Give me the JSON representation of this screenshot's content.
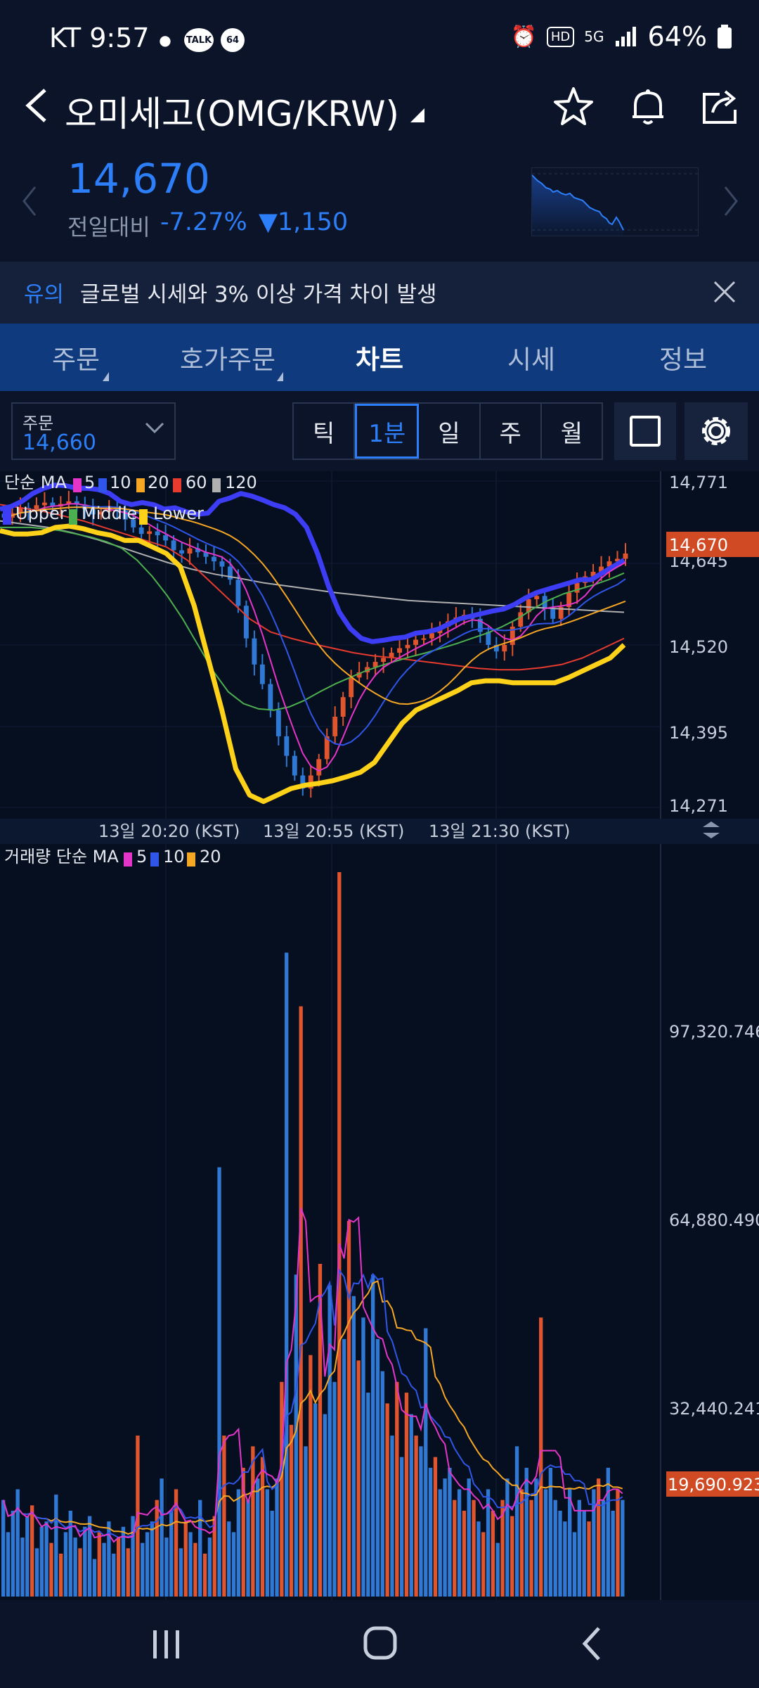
{
  "status_bar": {
    "carrier_time": "KT 9:57",
    "icons": [
      "location-icon",
      "talk-icon",
      "notification-dot-icon",
      "alarm-icon",
      "hd-icon",
      "5g-icon",
      "signal-icon",
      "battery-icon"
    ],
    "talk_label": "TALK",
    "dot_label": "64",
    "hd_label": "HD",
    "g5_label": "5G",
    "battery": "64%"
  },
  "header": {
    "title": "오미세고(OMG/KRW)"
  },
  "price": {
    "current": "14,670",
    "change_label": "전일대비",
    "change_pct": "-7.27%",
    "change_abs": "▼1,150",
    "color": "#2d7ff9"
  },
  "warning": {
    "tag": "유의",
    "text": "글로벌 시세와 3% 이상 가격 차이 발생"
  },
  "tabs": [
    {
      "label": "주문"
    },
    {
      "label": "호가주문"
    },
    {
      "label": "차트"
    },
    {
      "label": "시세"
    },
    {
      "label": "정보"
    }
  ],
  "toolbar": {
    "order_label": "주문",
    "order_value": "14,660",
    "intervals": [
      "틱",
      "1분",
      "일",
      "주",
      "월"
    ],
    "active_interval": "1분"
  },
  "chart_data": [
    {
      "type": "candlestick",
      "legend_ma": {
        "label": "단순 MA",
        "periods": [
          "5",
          "10",
          "20",
          "60",
          "120"
        ],
        "colors": [
          "#e535c8",
          "#2f56e8",
          "#f5a623",
          "#e63b2e",
          "#b0b0b0"
        ]
      },
      "legend_bb": {
        "labels": [
          "Upper",
          "Middle",
          "Lower"
        ],
        "colors": [
          "#3d3df5",
          "#4caf50",
          "#ffd21a"
        ]
      },
      "y_ticks": [
        "14,771",
        "14,645",
        "14,520",
        "14,395",
        "14,271"
      ],
      "y_range": [
        14271,
        14771
      ],
      "current_price_tag": "14,670",
      "x_ticks": [
        "13일 20:20 (KST)",
        "13일 20:55 (KST)",
        "13일 21:30 (KST)"
      ],
      "up_color": "#e0542e",
      "down_color": "#2f79d4",
      "close_series": [
        14715,
        14722,
        14730,
        14728,
        14734,
        14738,
        14732,
        14736,
        14740,
        14735,
        14728,
        14720,
        14724,
        14730,
        14726,
        14712,
        14700,
        14690,
        14694,
        14688,
        14680,
        14665,
        14660,
        14668,
        14662,
        14655,
        14648,
        14640,
        14620,
        14580,
        14530,
        14490,
        14460,
        14420,
        14380,
        14350,
        14320,
        14300,
        14320,
        14345,
        14380,
        14410,
        14440,
        14470,
        14478,
        14486,
        14494,
        14500,
        14508,
        14515,
        14520,
        14528,
        14530,
        14538,
        14548,
        14556,
        14562,
        14566,
        14560,
        14540,
        14520,
        14510,
        14520,
        14548,
        14570,
        14590,
        14595,
        14575,
        14560,
        14578,
        14600,
        14615,
        14625,
        14632,
        14640,
        14648,
        14652,
        14660
      ],
      "ma_values": {
        "upper": [
          14728,
          14732,
          14740,
          14752,
          14760,
          14765,
          14764,
          14760,
          14760,
          14758,
          14752,
          14740,
          14735,
          14738,
          14735,
          14728,
          14730,
          14724,
          14720,
          14722,
          14740,
          14745,
          14752,
          14748,
          14742,
          14735,
          14730,
          14720,
          14700,
          14660,
          14610,
          14570,
          14545,
          14530,
          14525,
          14527,
          14530,
          14532,
          14538,
          14540,
          14544,
          14552,
          14560,
          14564,
          14568,
          14572,
          14575,
          14582,
          14592,
          14600,
          14605,
          14610,
          14615,
          14620,
          14620,
          14630,
          14640,
          14650
        ],
        "middle": [
          14700,
          14700,
          14700,
          14698,
          14695,
          14690,
          14685,
          14678,
          14668,
          14650,
          14625,
          14595,
          14560,
          14520,
          14480,
          14448,
          14430,
          14422,
          14420,
          14425,
          14435,
          14448,
          14460,
          14470,
          14480,
          14488,
          14495,
          14502,
          14508,
          14515,
          14522,
          14530,
          14538,
          14548,
          14560,
          14575,
          14588,
          14598,
          14605,
          14612,
          14620,
          14630
        ],
        "lower": [
          14695,
          14690,
          14690,
          14692,
          14700,
          14702,
          14698,
          14692,
          14688,
          14680,
          14680,
          14670,
          14660,
          14640,
          14580,
          14500,
          14420,
          14330,
          14290,
          14280,
          14290,
          14300,
          14305,
          14308,
          14312,
          14318,
          14325,
          14340,
          14370,
          14400,
          14420,
          14430,
          14440,
          14450,
          14462,
          14465,
          14465,
          14462,
          14462,
          14462,
          14462,
          14470,
          14480,
          14490,
          14500,
          14520
        ],
        "ma60": [
          14735,
          14730,
          14725,
          14718,
          14710,
          14700,
          14690,
          14680,
          14670,
          14650,
          14620,
          14590,
          14560,
          14540,
          14530,
          14522,
          14515,
          14508,
          14503,
          14500,
          14496,
          14492,
          14488,
          14484,
          14482,
          14482,
          14485,
          14490,
          14500,
          14515,
          14530
        ],
        "ma120": [
          14710,
          14705,
          14700,
          14692,
          14682,
          14670,
          14658,
          14646,
          14636,
          14628,
          14622,
          14615,
          14610,
          14605,
          14600,
          14596,
          14592,
          14588,
          14586,
          14584,
          14582,
          14580,
          14578,
          14576,
          14574,
          14572,
          14570
        ]
      }
    },
    {
      "type": "bar",
      "legend": {
        "label": "거래량 단순 MA",
        "periods": [
          "5",
          "10",
          "20"
        ],
        "colors": [
          "#e535c8",
          "#2f56e8",
          "#f5a623"
        ]
      },
      "y_ticks": [
        "97,320.746",
        "64,880.490",
        "32,440.241"
      ],
      "current_volume_tag": "19,690.923",
      "y_range": [
        0,
        135000
      ],
      "values": [
        18000,
        12000,
        16000,
        20000,
        11000,
        15000,
        17000,
        9000,
        13000,
        14000,
        10000,
        19000,
        8000,
        12000,
        16000,
        11000,
        9000,
        13000,
        15000,
        7000,
        12000,
        10000,
        14000,
        8000,
        11000,
        13000,
        9000,
        15000,
        30000,
        10000,
        12000,
        14000,
        18000,
        22000,
        11000,
        16000,
        20000,
        9000,
        14000,
        12000,
        10000,
        18000,
        8000,
        11000,
        15000,
        80000,
        30000,
        14000,
        12000,
        20000,
        24000,
        18000,
        28000,
        22000,
        26000,
        20000,
        16000,
        22000,
        40000,
        120000,
        32000,
        60000,
        110000,
        28000,
        45000,
        36000,
        62000,
        34000,
        58000,
        40000,
        135000,
        48000,
        70000,
        56000,
        44000,
        52000,
        38000,
        60000,
        48000,
        42000,
        36000,
        30000,
        40000,
        26000,
        38000,
        34000,
        30000,
        28000,
        50000,
        24000,
        26000,
        20000,
        22000,
        24000,
        18000,
        20000,
        16000,
        22000,
        18000,
        14000,
        12000,
        20000,
        16000,
        10000,
        18000,
        22000,
        15000,
        28000,
        20000,
        24000,
        18000,
        22000,
        52000,
        20000,
        24000,
        18000,
        16000,
        14000,
        20000,
        12000,
        18000,
        16000,
        14000,
        20000,
        22000,
        18000,
        24000,
        16000,
        20000,
        18000
      ],
      "up_color": "#e0542e",
      "down_color": "#2f79d4"
    }
  ],
  "bottom_nav": [
    "recents-icon",
    "home-icon",
    "back-icon"
  ]
}
